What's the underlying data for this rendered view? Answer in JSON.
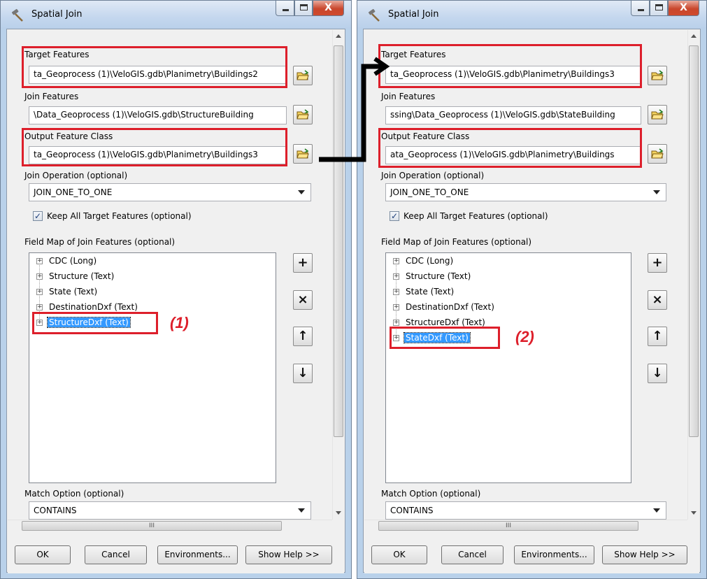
{
  "left": {
    "title": "Spatial Join",
    "close_glyph": "X",
    "target_label": "Target Features",
    "target_value": "ta_Geoprocess (1)\\VeloGIS.gdb\\Planimetry\\Buildings2",
    "join_label": "Join Features",
    "join_value": "\\Data_Geoprocess (1)\\VeloGIS.gdb\\StructureBuilding",
    "output_label": "Output Feature Class",
    "output_value": "ta_Geoprocess (1)\\VeloGIS.gdb\\Planimetry\\Buildings3",
    "operation_label": "Join Operation (optional)",
    "operation_value": "JOIN_ONE_TO_ONE",
    "keep_label": "Keep All Target Features (optional)",
    "keep_checked": "✓",
    "fieldmap_label": "Field Map of Join Features (optional)",
    "fields": [
      "CDC (Long)",
      "Structure (Text)",
      "State (Text)",
      "DestinationDxf (Text)",
      "StructureDxf (Text)"
    ],
    "annotation": "(1)",
    "match_label": "Match Option (optional)",
    "match_value": "CONTAINS",
    "hscroll_grip": "III"
  },
  "right": {
    "title": "Spatial Join",
    "close_glyph": "X",
    "target_label": "Target Features",
    "target_value": "ta_Geoprocess (1)\\VeloGIS.gdb\\Planimetry\\Buildings3",
    "join_label": "Join Features",
    "join_value": "ssing\\Data_Geoprocess (1)\\VeloGIS.gdb\\StateBuilding",
    "output_label": "Output Feature Class",
    "output_value": "ata_Geoprocess (1)\\VeloGIS.gdb\\Planimetry\\Buildings",
    "operation_label": "Join Operation (optional)",
    "operation_value": "JOIN_ONE_TO_ONE",
    "keep_label": "Keep All Target Features (optional)",
    "keep_checked": "✓",
    "fieldmap_label": "Field Map of Join Features (optional)",
    "fields": [
      "CDC (Long)",
      "Structure (Text)",
      "State (Text)",
      "DestinationDxf (Text)",
      "StructureDxf (Text)",
      "StateDxf (Text)"
    ],
    "annotation": "(2)",
    "match_label": "Match Option (optional)",
    "match_value": "CONTAINS",
    "hscroll_grip": "III"
  },
  "buttons": {
    "ok": "OK",
    "cancel": "Cancel",
    "environments": "Environments...",
    "help": "Show Help >>"
  },
  "side_buttons": {
    "add": "+",
    "remove": "×",
    "up": "↑",
    "down": "↓"
  },
  "colors": {
    "highlight": "#dd1f2b",
    "selection": "#3399ff"
  }
}
